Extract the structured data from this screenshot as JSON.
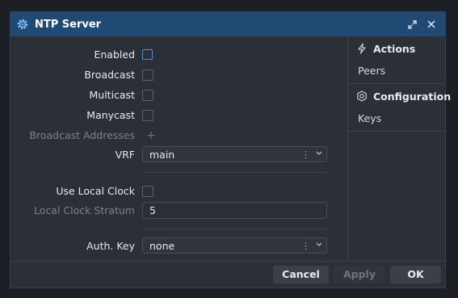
{
  "window": {
    "title": "NTP Server",
    "accent_color": "#1f4a73",
    "icons": {
      "title": "gear-icon",
      "restore": "restore-icon",
      "close": "close-icon"
    }
  },
  "form": {
    "enabled_label": "Enabled",
    "enabled_checked": false,
    "broadcast_label": "Broadcast",
    "broadcast_checked": false,
    "multicast_label": "Multicast",
    "multicast_checked": false,
    "manycast_label": "Manycast",
    "manycast_checked": false,
    "broadcast_addresses_label": "Broadcast Addresses",
    "add_icon": "+",
    "vrf_label": "VRF",
    "vrf_value": "main",
    "use_local_clock_label": "Use Local Clock",
    "use_local_clock_checked": false,
    "local_clock_stratum_label": "Local Clock Stratum",
    "local_clock_stratum_value": "5",
    "auth_key_label": "Auth. Key",
    "auth_key_value": "none",
    "select_menu_glyph": "⋮",
    "select_chevron_glyph": "⌄"
  },
  "sidebar": {
    "actions_header": "Actions",
    "actions_items": [
      "Peers"
    ],
    "configuration_header": "Configuration",
    "configuration_items": [
      "Keys"
    ]
  },
  "footer": {
    "cancel_label": "Cancel",
    "apply_label": "Apply",
    "ok_label": "OK"
  }
}
